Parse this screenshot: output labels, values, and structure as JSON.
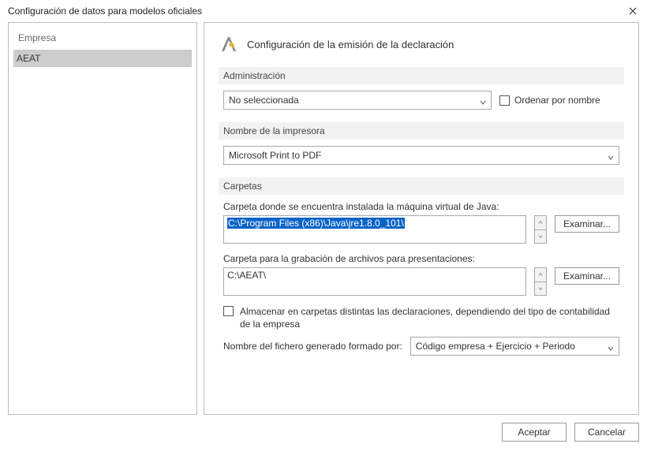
{
  "window": {
    "title": "Configuración de datos para modelos oficiales"
  },
  "sidebar": {
    "header": "Empresa",
    "selected": "AEAT"
  },
  "main": {
    "heading": "Configuración de la emisión de la declaración",
    "groups": {
      "admin": {
        "label": "Administración",
        "select_value": "No seleccionada",
        "order_checkbox_label": "Ordenar por nombre"
      },
      "printer": {
        "label": "Nombre de la impresora",
        "select_value": "Microsoft Print to PDF"
      },
      "folders": {
        "label": "Carpetas",
        "java_label": "Carpeta donde se encuentra instalada la máquina virtual de Java:",
        "java_path": "C:\\Program Files (x86)\\Java\\jre1.8.0_101\\",
        "rec_label": "Carpeta para la grabación de archivos para presentaciones:",
        "rec_path": "C:\\AEAT\\",
        "browse_label": "Examinar...",
        "split_checkbox_label": "Almacenar en carpetas distintas las declaraciones, dependiendo del tipo de contabilidad de la empresa",
        "filename_label": "Nombre del fichero generado formado por:",
        "filename_select_value": "Código empresa + Ejercicio + Periodo"
      }
    }
  },
  "footer": {
    "ok": "Aceptar",
    "cancel": "Cancelar"
  }
}
